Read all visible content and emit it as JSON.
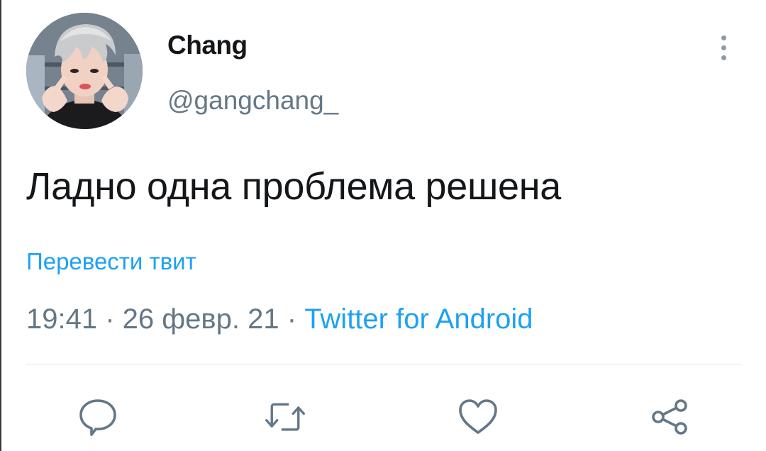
{
  "tweet": {
    "author": {
      "display_name": "Chang",
      "handle": "@gangchang_"
    },
    "text": "Ладно одна проблема решена",
    "translate_label": "Перевести твит",
    "meta": {
      "time": "19:41",
      "separator": " · ",
      "date": "26 февр. 21",
      "source": "Twitter for Android"
    }
  },
  "actions": [
    {
      "name": "reply",
      "icon": "reply-icon"
    },
    {
      "name": "retweet",
      "icon": "retweet-icon"
    },
    {
      "name": "like",
      "icon": "heart-icon"
    },
    {
      "name": "share",
      "icon": "share-icon"
    }
  ],
  "colors": {
    "accent": "#1da1f2",
    "secondary_text": "#657786",
    "primary_text": "#14171a",
    "divider": "#e1e8ed"
  }
}
